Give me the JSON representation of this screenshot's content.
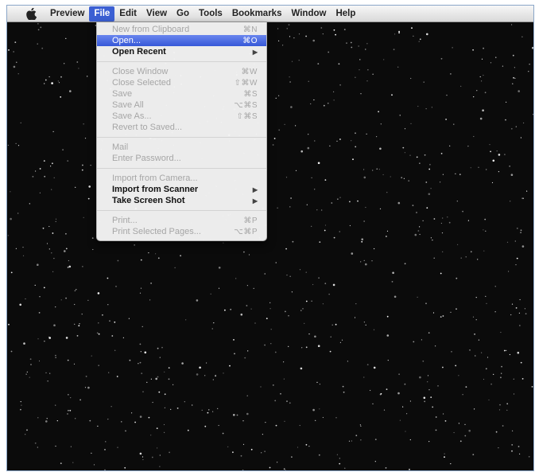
{
  "menubar": {
    "apple_icon": "apple-icon",
    "items": [
      "Preview",
      "File",
      "Edit",
      "View",
      "Go",
      "Tools",
      "Bookmarks",
      "Window",
      "Help"
    ],
    "active_item": "File"
  },
  "file_menu": {
    "groups": [
      [
        {
          "label": "New from Clipboard",
          "shortcut": "⌘N",
          "enabled": false
        },
        {
          "label": "Open...",
          "shortcut": "⌘O",
          "enabled": true,
          "selected": true
        },
        {
          "label": "Open Recent",
          "shortcut": "",
          "enabled": true,
          "submenu": true
        }
      ],
      [
        {
          "label": "Close Window",
          "shortcut": "⌘W",
          "enabled": false
        },
        {
          "label": "Close Selected",
          "shortcut": "⇧⌘W",
          "enabled": false
        },
        {
          "label": "Save",
          "shortcut": "⌘S",
          "enabled": false
        },
        {
          "label": "Save All",
          "shortcut": "⌥⌘S",
          "enabled": false
        },
        {
          "label": "Save As...",
          "shortcut": "⇧⌘S",
          "enabled": false
        },
        {
          "label": "Revert to Saved...",
          "shortcut": "",
          "enabled": false
        }
      ],
      [
        {
          "label": "Mail",
          "shortcut": "",
          "enabled": false
        },
        {
          "label": "Enter Password...",
          "shortcut": "",
          "enabled": false
        }
      ],
      [
        {
          "label": "Import from Camera...",
          "shortcut": "",
          "enabled": false
        },
        {
          "label": "Import from Scanner",
          "shortcut": "",
          "enabled": true,
          "submenu": true
        },
        {
          "label": "Take Screen Shot",
          "shortcut": "",
          "enabled": true,
          "submenu": true
        }
      ],
      [
        {
          "label": "Print...",
          "shortcut": "⌘P",
          "enabled": false
        },
        {
          "label": "Print Selected Pages...",
          "shortcut": "⌥⌘P",
          "enabled": false
        }
      ]
    ]
  },
  "colors": {
    "desktop": "#0b0b0b",
    "highlight": "#3b5fd3",
    "disabled_text": "#a6a6a6"
  }
}
